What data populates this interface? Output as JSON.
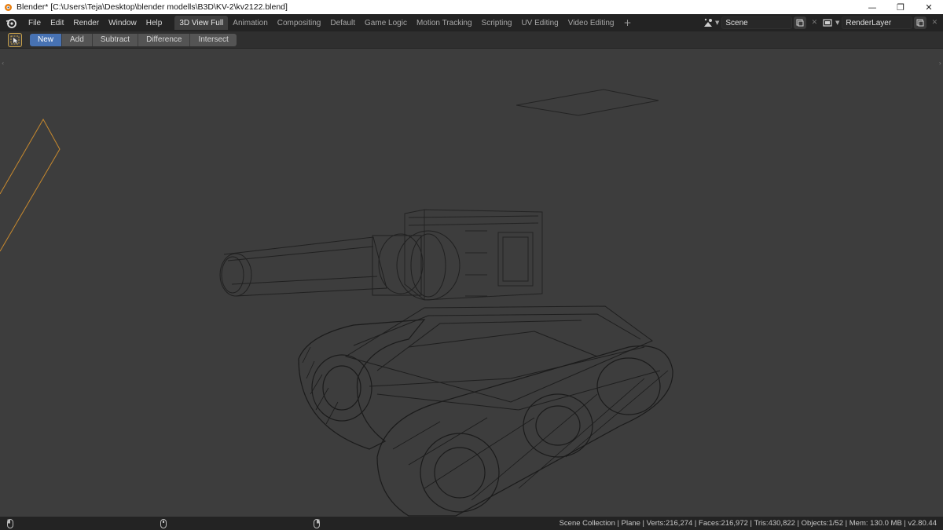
{
  "window": {
    "title": "Blender* [C:\\Users\\Teja\\Desktop\\blender modells\\B3D\\KV-2\\kv2122.blend]",
    "minimize": "—",
    "maximize": "❐",
    "close": "✕"
  },
  "menu": [
    "File",
    "Edit",
    "Render",
    "Window",
    "Help"
  ],
  "workspaces": {
    "active": "3D View Full",
    "tabs": [
      "3D View Full",
      "Animation",
      "Compositing",
      "Default",
      "Game Logic",
      "Motion Tracking",
      "Scripting",
      "UV Editing",
      "Video Editing"
    ],
    "add": "+"
  },
  "scene": {
    "name": "Scene"
  },
  "render_layer": {
    "name": "RenderLayer"
  },
  "tool_modes": {
    "active": "New",
    "items": [
      "New",
      "Add",
      "Subtract",
      "Difference",
      "Intersect"
    ]
  },
  "status": {
    "text": "Scene Collection | Plane | Verts:216,274 | Faces:216,972 | Tris:430,822 | Objects:1/52 | Mem: 130.0 MB | v2.80.44"
  },
  "colors": {
    "accent": "#4772b3",
    "viewport_bg": "#3d3d3d",
    "wire": "#1e1e1e",
    "selected_outline": "#c98a2e"
  },
  "icons": [
    "blender-logo-icon",
    "select-box-icon",
    "scene-icon",
    "render-layer-icon",
    "mouse-left-icon",
    "mouse-middle-icon",
    "mouse-right-icon"
  ]
}
